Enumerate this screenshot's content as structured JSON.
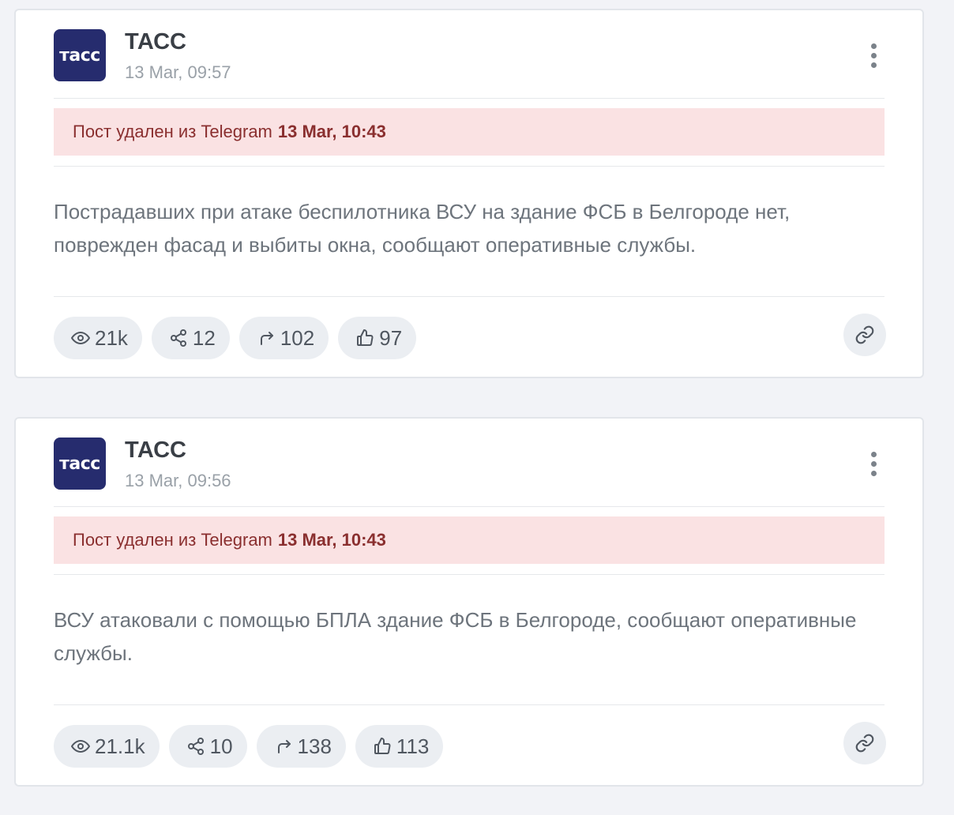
{
  "posts": [
    {
      "channel": "ТАСС",
      "avatar_text": "тасс",
      "time": "13 Mar, 09:57",
      "deleted_prefix": "Пост удален из Telegram",
      "deleted_date": "13 Mar, 10:43",
      "text": "Пострадавших при атаке беспилотника ВСУ на здание ФСБ в Белгороде нет, поврежден фасад и выбиты окна, сообщают оперативные службы.",
      "stats": {
        "views": "21k",
        "shares": "12",
        "forwards": "102",
        "likes": "97"
      }
    },
    {
      "channel": "ТАСС",
      "avatar_text": "тасс",
      "time": "13 Mar, 09:56",
      "deleted_prefix": "Пост удален из Telegram",
      "deleted_date": "13 Mar, 10:43",
      "text": "ВСУ атаковали с помощью БПЛА здание ФСБ в Белгороде, сообщают оперативные службы.",
      "stats": {
        "views": "21.1k",
        "shares": "10",
        "forwards": "138",
        "likes": "113"
      }
    }
  ],
  "icons": {
    "views": "eye-icon",
    "shares": "share-icon",
    "forwards": "forward-arrow-icon",
    "likes": "thumbs-up-icon",
    "link": "link-icon",
    "more": "more-vertical-icon"
  },
  "colors": {
    "brand_avatar": "#262c6e",
    "deleted_bg": "#fae2e3",
    "deleted_text": "#8a2f2f",
    "pill_bg": "#ebeef2"
  }
}
